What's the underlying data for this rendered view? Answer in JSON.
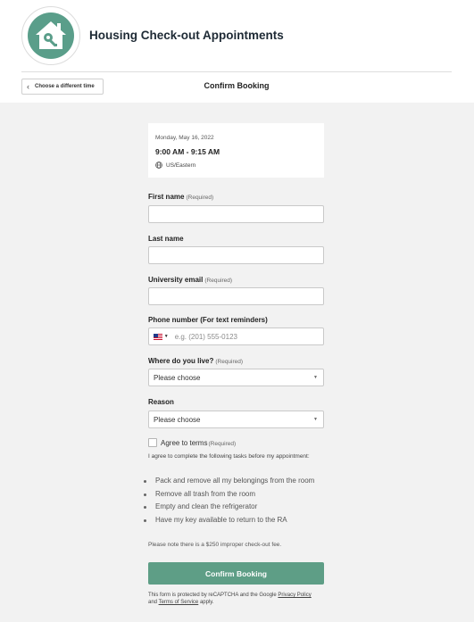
{
  "header": {
    "app_title": "Housing Check-out Appointments",
    "back_label": "Choose a different time",
    "page_heading": "Confirm Booking",
    "logo_icon": "house-key-logo",
    "brand_color": "#5a9e8a"
  },
  "summary": {
    "date": "Monday, May 16, 2022",
    "time": "9:00 AM - 9:15 AM",
    "timezone": "US/Eastern"
  },
  "form": {
    "first_name": {
      "label": "First name",
      "required": "(Required)",
      "value": ""
    },
    "last_name": {
      "label": "Last name",
      "value": ""
    },
    "email": {
      "label": "University email",
      "required": "(Required)",
      "value": ""
    },
    "phone": {
      "label": "Phone number (For text reminders)",
      "placeholder": "e.g. (201) 555-0123",
      "country": "US"
    },
    "residence": {
      "label": "Where do you live?",
      "required": "(Required)",
      "selected": "Please choose"
    },
    "reason": {
      "label": "Reason",
      "selected": "Please choose"
    },
    "agree": {
      "label": "Agree to terms",
      "required": "(Required)",
      "checked": false
    },
    "terms_intro": "I agree to complete the following tasks before my appointment:",
    "tasks": [
      "Pack and remove all my belongings from the room",
      "Remove all trash from the room",
      "Empty and clean the refrigerator",
      "Have my key available to return to the RA"
    ],
    "fee_note": "Please note there is a $250 improper check-out fee.",
    "submit_label": "Confirm Booking",
    "submit_color": "#5e9e86"
  },
  "legal": {
    "prefix": "This form is protected by reCAPTCHA and the Google ",
    "privacy": "Privacy Policy",
    "and": "and",
    "terms": "Terms of Service",
    "suffix": "apply."
  }
}
